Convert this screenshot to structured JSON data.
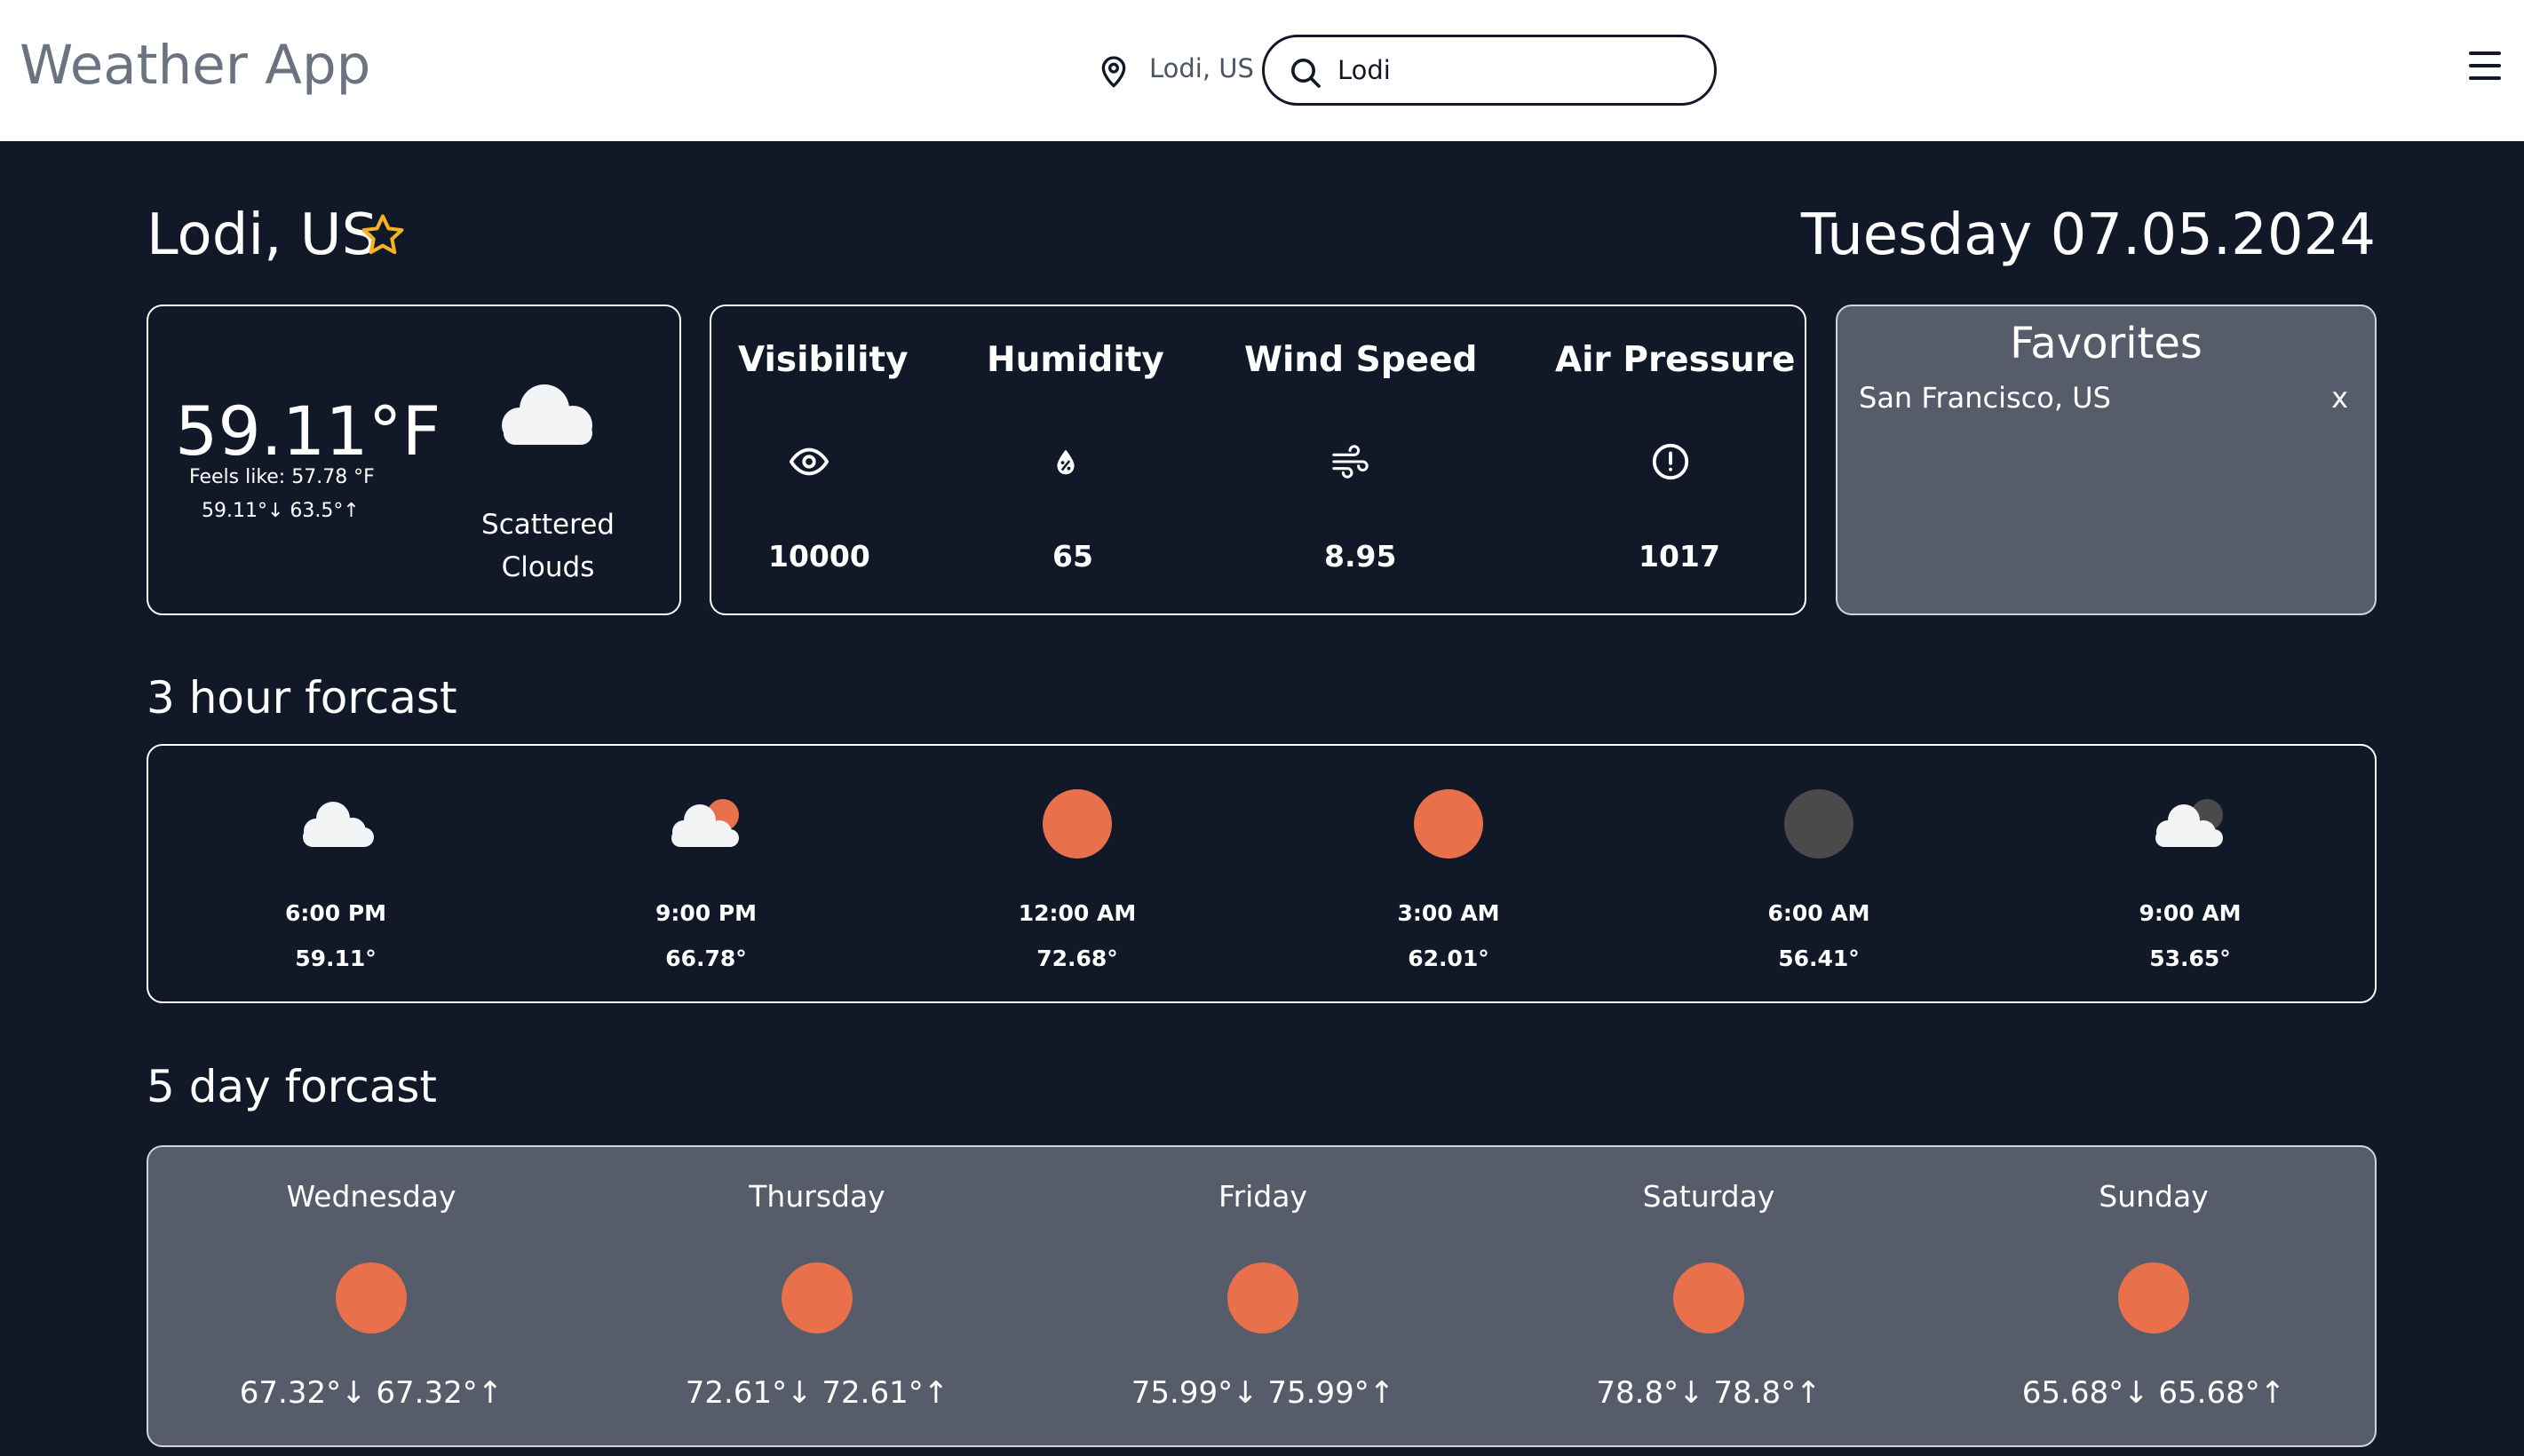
{
  "header": {
    "app_title": "Weather App",
    "location_label": "Lodi, US",
    "search_value": "Lodi",
    "icons": {
      "location": "map-pin-icon",
      "search": "search-icon",
      "menu": "hamburger-menu-icon"
    }
  },
  "main": {
    "city": "Lodi, US",
    "favorite_icon": "star-outline-icon",
    "date": "Tuesday 07.05.2024"
  },
  "current": {
    "temperature": "59.11°F",
    "feels_like": "Feels like: 57.78 °F",
    "min_max": "59.11°↓ 63.5°↑",
    "icon": "cloud-icon",
    "description": "Scattered Clouds"
  },
  "stats": [
    {
      "label": "Visibility",
      "icon": "eye-icon",
      "value": "10000"
    },
    {
      "label": "Humidity",
      "icon": "humidity-drop-icon",
      "value": "65"
    },
    {
      "label": "Wind Speed",
      "icon": "wind-icon",
      "value": "8.95"
    },
    {
      "label": "Air Pressure",
      "icon": "alert-circle-icon",
      "value": "1017"
    }
  ],
  "favorites": {
    "title": "Favorites",
    "items": [
      {
        "name": "San Francisco, US",
        "remove_label": "x"
      }
    ]
  },
  "hourly": {
    "title": "3 hour forcast",
    "items": [
      {
        "time": "6:00 PM",
        "temp": "59.11°",
        "icon": "cloud-icon"
      },
      {
        "time": "9:00 PM",
        "temp": "66.78°",
        "icon": "cloud-sun-icon"
      },
      {
        "time": "12:00 AM",
        "temp": "72.68°",
        "icon": "sun-icon"
      },
      {
        "time": "3:00 AM",
        "temp": "62.01°",
        "icon": "sun-icon"
      },
      {
        "time": "6:00 AM",
        "temp": "56.41°",
        "icon": "moon-icon"
      },
      {
        "time": "9:00 AM",
        "temp": "53.65°",
        "icon": "cloud-moon-icon"
      }
    ]
  },
  "daily": {
    "title": "5 day forcast",
    "items": [
      {
        "day": "Wednesday",
        "temps": "67.32°↓ 67.32°↑",
        "icon": "sun-icon"
      },
      {
        "day": "Thursday",
        "temps": "72.61°↓ 72.61°↑",
        "icon": "sun-icon"
      },
      {
        "day": "Friday",
        "temps": "75.99°↓ 75.99°↑",
        "icon": "sun-icon"
      },
      {
        "day": "Saturday",
        "temps": "78.8°↓ 78.8°↑",
        "icon": "sun-icon"
      },
      {
        "day": "Sunday",
        "temps": "65.68°↓ 65.68°↑",
        "icon": "sun-icon"
      }
    ]
  },
  "colors": {
    "background": "#111827",
    "header": "#ffffff",
    "panel_gray": "#565c6a",
    "sun": "#e8704a",
    "moon": "#4a4a4a",
    "star": "#f5b323",
    "cloud": "#f3f4f6"
  }
}
